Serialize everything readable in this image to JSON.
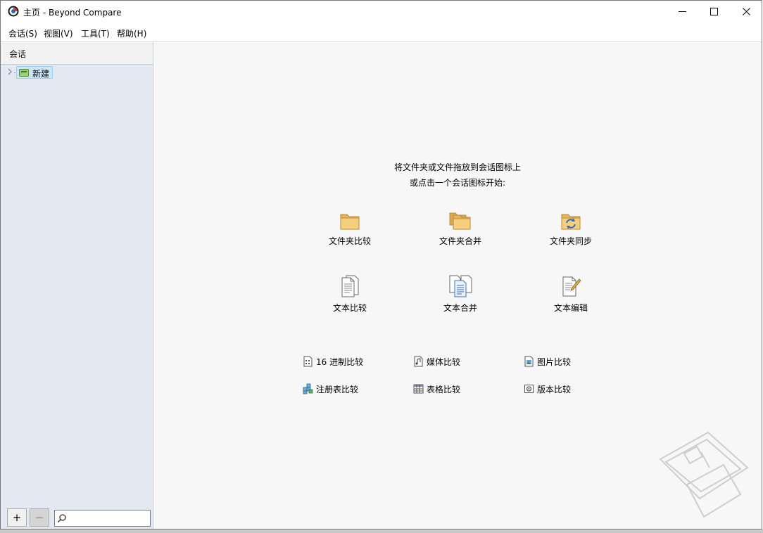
{
  "window": {
    "title": "主页 - Beyond Compare"
  },
  "menu": [
    {
      "label": "会话(S)"
    },
    {
      "label": "视图(V)"
    },
    {
      "label": "工具(T)"
    },
    {
      "label": "帮助(H)"
    }
  ],
  "sidebar": {
    "header": "会话",
    "tree": [
      {
        "label": "新建",
        "selected": true
      }
    ],
    "add_label": "+",
    "remove_label": "−",
    "search_value": ""
  },
  "main": {
    "intro_line1": "将文件夹或文件拖放到会话图标上",
    "intro_line2": "或点击一个会话图标开始:",
    "big_tiles": [
      {
        "label": "文件夹比较",
        "icon": "folder-icon"
      },
      {
        "label": "文件夹合并",
        "icon": "folder-merge-icon"
      },
      {
        "label": "文件夹同步",
        "icon": "folder-sync-icon"
      },
      {
        "label": "文本比较",
        "icon": "text-document-icon"
      },
      {
        "label": "文本合并",
        "icon": "text-merge-icon"
      },
      {
        "label": "文本编辑",
        "icon": "text-edit-icon"
      }
    ],
    "small_tiles": [
      {
        "label": "16 进制比较",
        "icon": "hex-icon"
      },
      {
        "label": "媒体比较",
        "icon": "media-icon"
      },
      {
        "label": "图片比较",
        "icon": "picture-icon"
      },
      {
        "label": "注册表比较",
        "icon": "registry-icon"
      },
      {
        "label": "表格比较",
        "icon": "table-icon"
      },
      {
        "label": "版本比较",
        "icon": "version-icon"
      }
    ]
  },
  "colors": {
    "sidebar_bg": "#e4e8f0",
    "main_bg": "#f7f7f7",
    "selection_bg": "#cde6f7",
    "folder": "#f0c36b"
  }
}
